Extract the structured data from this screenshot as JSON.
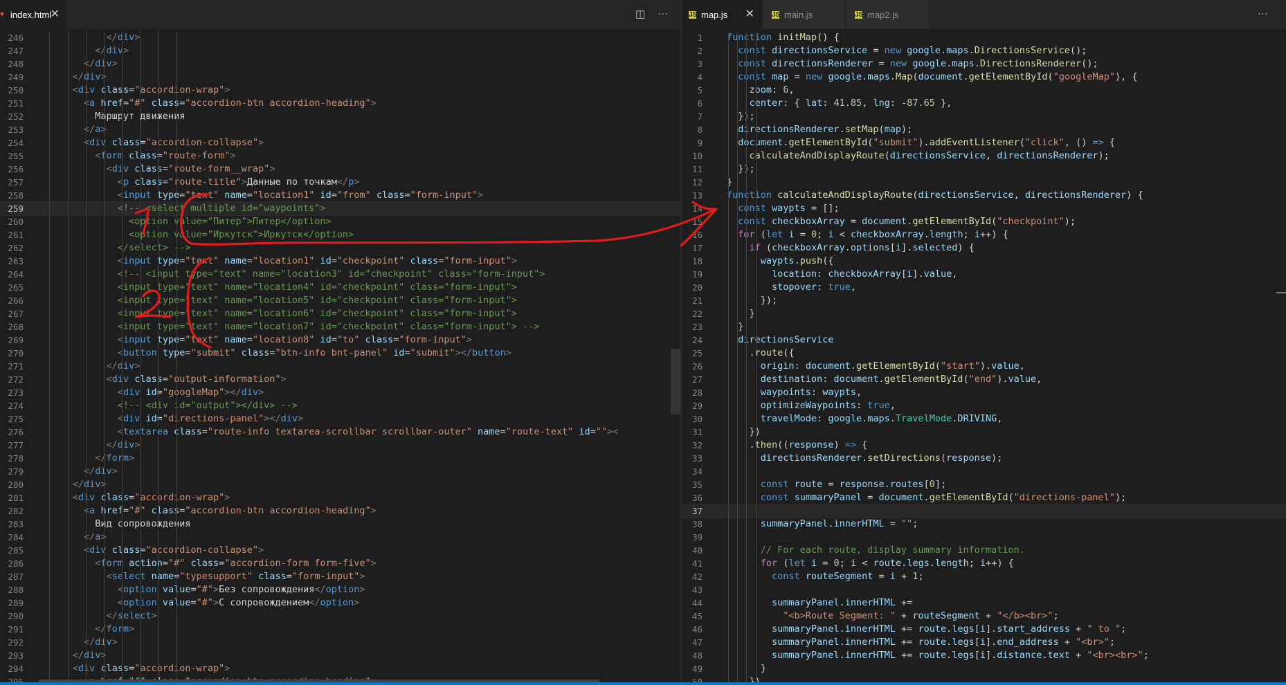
{
  "left": {
    "tab": {
      "label": "index.html",
      "icon": "html5-icon",
      "close": "✕"
    },
    "actions": {
      "split": "◫",
      "more": "···"
    },
    "start": 246,
    "current": 259,
    "lines": [
      "            </div>",
      "          </div>",
      "        </div>",
      "      </div>",
      "      <div class=\"accordion-wrap\">",
      "        <a href=\"#\" class=\"accordion-btn accordion-heading\">",
      "          Маршрут движения",
      "        </a>",
      "        <div class=\"accordion-collapse\">",
      "          <form class=\"route-form\">",
      "            <div class=\"route-form__wrap\">",
      "              <p class=\"route-title\">Данные по точкам</p>",
      "              <input type=\"text\" name=\"location1\" id=\"from\" class=\"form-input\">",
      "              <!-- <select multiple id=\"waypoints\">",
      "                <option value=\"Питер\">Питер</option>",
      "                <option value=\"Иркутск\">Иркутск</option>",
      "              </select> -->",
      "              <input type=\"text\" name=\"location1\" id=\"checkpoint\" class=\"form-input\">",
      "              <!-- <input type=\"text\" name=\"location3\" id=\"checkpoint\" class=\"form-input\">",
      "              <input type=\"text\" name=\"location4\" id=\"checkpoint\" class=\"form-input\">",
      "              <input type=\"text\" name=\"location5\" id=\"checkpoint\" class=\"form-input\">",
      "              <input type=\"text\" name=\"location6\" id=\"checkpoint\" class=\"form-input\">",
      "              <input type=\"text\" name=\"location7\" id=\"checkpoint\" class=\"form-input\"> -->",
      "              <input type=\"text\" name=\"location8\" id=\"to\" class=\"form-input\">",
      "              <button type=\"submit\" class=\"btn-info bnt-panel\" id=\"submit\"></button>",
      "            </div>",
      "            <div class=\"output-information\">",
      "              <div id=\"googleMap\"></div>",
      "              <!-- <div id=\"output\"></div> -->",
      "              <div id=\"directions-panel\"></div>",
      "              <textarea class=\"route-info textarea-scrollbar scrollbar-outer\" name=\"route-text\" id=\"\"><",
      "            </div>",
      "          </form>",
      "        </div>",
      "      </div>",
      "      <div class=\"accordion-wrap\">",
      "        <a href=\"#\" class=\"accordion-btn accordion-heading\">",
      "          Вид сопровождения",
      "        </a>",
      "        <div class=\"accordion-collapse\">",
      "          <form action=\"#\" class=\"accordion-form form-five\">",
      "            <select name=\"typesupport\" class=\"form-input\">",
      "              <option value=\"#\">Без сопровождения</option>",
      "              <option value=\"#\">С сопровождением</option>",
      "            </select>",
      "          </form>",
      "        </div>",
      "      </div>",
      "      <div class=\"accordion-wrap\">",
      "        <a href=\"#\" class=\"accordion-btn accordion-heading\">"
    ]
  },
  "right": {
    "tabs": [
      {
        "label": "map.js",
        "icon": "js-icon",
        "close": "✕",
        "active": true
      },
      {
        "label": "main.js",
        "icon": "js-icon",
        "active": false
      },
      {
        "label": "map2.js",
        "icon": "js-icon",
        "active": false
      }
    ],
    "actions": {
      "more": "···"
    },
    "start": 1,
    "current": 37,
    "lines": [
      "function initMap() {",
      "  const directionsService = new google.maps.DirectionsService();",
      "  const directionsRenderer = new google.maps.DirectionsRenderer();",
      "  const map = new google.maps.Map(document.getElementById(\"googleMap\"), {",
      "    zoom: 6,",
      "    center: { lat: 41.85, lng: -87.65 },",
      "  });",
      "  directionsRenderer.setMap(map);",
      "  document.getElementById(\"submit\").addEventListener(\"click\", () => {",
      "    calculateAndDisplayRoute(directionsService, directionsRenderer);",
      "  });",
      "}",
      "function calculateAndDisplayRoute(directionsService, directionsRenderer) {",
      "  const waypts = [];",
      "  const checkboxArray = document.getElementById(\"checkpoint\");",
      "  for (let i = 0; i < checkboxArray.length; i++) {",
      "    if (checkboxArray.options[i].selected) {",
      "      waypts.push({",
      "        location: checkboxArray[i].value,",
      "        stopover: true,",
      "      });",
      "    }",
      "  }",
      "  directionsService",
      "    .route({",
      "      origin: document.getElementById(\"start\").value,",
      "      destination: document.getElementById(\"end\").value,",
      "      waypoints: waypts,",
      "      optimizeWaypoints: true,",
      "      travelMode: google.maps.TravelMode.DRIVING,",
      "    })",
      "    .then((response) => {",
      "      directionsRenderer.setDirections(response);",
      "",
      "      const route = response.routes[0];",
      "      const summaryPanel = document.getElementById(\"directions-panel\");",
      "",
      "      summaryPanel.innerHTML = \"\";",
      "",
      "      // For each route, display summary information.",
      "      for (let i = 0; i < route.legs.length; i++) {",
      "        const routeSegment = i + 1;",
      "",
      "        summaryPanel.innerHTML +=",
      "          \"<b>Route Segment: \" + routeSegment + \"</b><br>\";",
      "        summaryPanel.innerHTML += route.legs[i].start_address + \" to \";",
      "        summaryPanel.innerHTML += route.legs[i].end_address + \"<br>\";",
      "        summaryPanel.innerHTML += route.legs[i].distance.text + \"<br><br>\";",
      "      }",
      "    })"
    ]
  },
  "annotations": {
    "mark1": "1",
    "mark2": "2"
  },
  "colors": {
    "annotation": "#e31b1b",
    "editor_bg": "#1e1e1e",
    "tab_bar": "#252526",
    "accent": "#007acc"
  }
}
